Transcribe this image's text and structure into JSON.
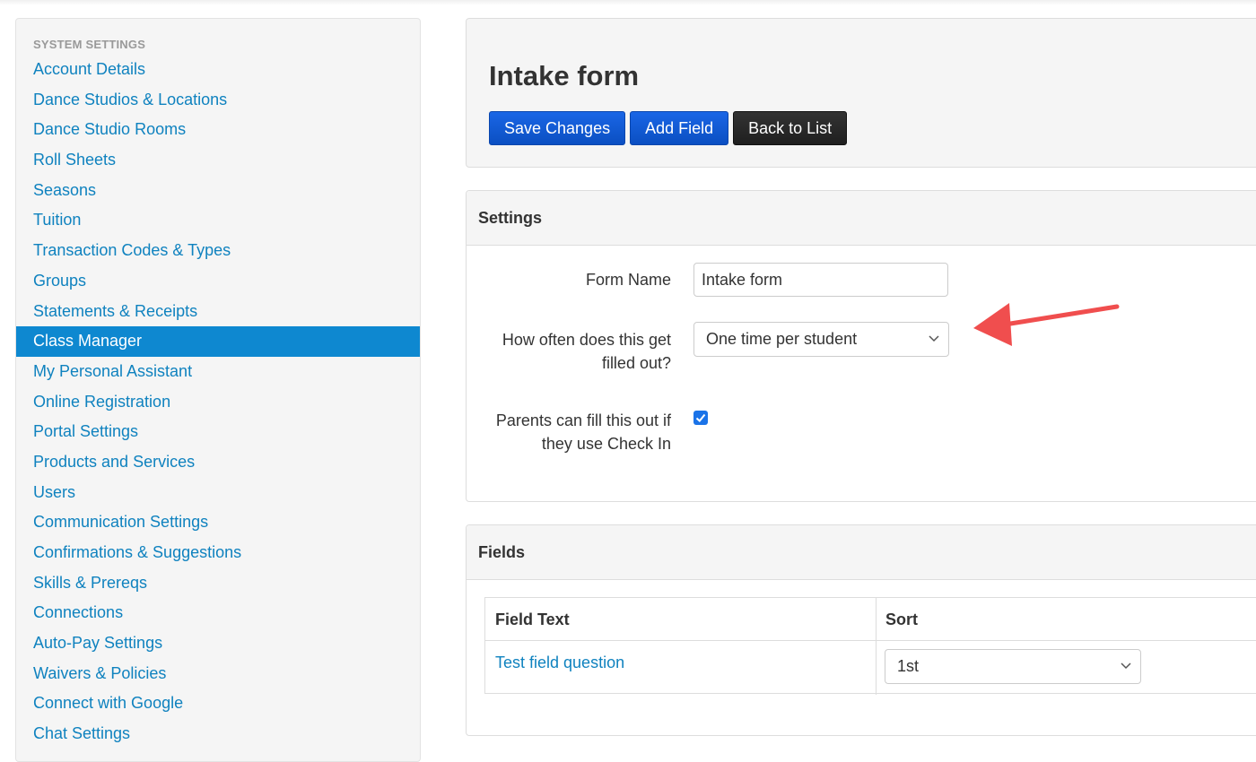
{
  "sidebar": {
    "header": "SYSTEM SETTINGS",
    "items": [
      {
        "label": "Account Details"
      },
      {
        "label": "Dance Studios & Locations"
      },
      {
        "label": "Dance Studio Rooms"
      },
      {
        "label": "Roll Sheets"
      },
      {
        "label": "Seasons"
      },
      {
        "label": "Tuition"
      },
      {
        "label": "Transaction Codes & Types"
      },
      {
        "label": "Groups"
      },
      {
        "label": "Statements & Receipts"
      },
      {
        "label": "Class Manager",
        "active": true
      },
      {
        "label": "My Personal Assistant"
      },
      {
        "label": "Online Registration"
      },
      {
        "label": "Portal Settings"
      },
      {
        "label": "Products and Services"
      },
      {
        "label": "Users"
      },
      {
        "label": "Communication Settings"
      },
      {
        "label": "Confirmations & Suggestions"
      },
      {
        "label": "Skills & Prereqs"
      },
      {
        "label": "Connections"
      },
      {
        "label": "Auto-Pay Settings"
      },
      {
        "label": "Waivers & Policies"
      },
      {
        "label": "Connect with Google"
      },
      {
        "label": "Chat Settings"
      }
    ]
  },
  "page": {
    "title": "Intake form",
    "buttons": {
      "save": "Save Changes",
      "add_field": "Add Field",
      "back": "Back to List"
    }
  },
  "settings": {
    "heading": "Settings",
    "form_name": {
      "label": "Form Name",
      "value": "Intake form"
    },
    "frequency": {
      "label": "How often does this get filled out?",
      "value": "One time per student"
    },
    "parents_checkin": {
      "label": "Parents can fill this out if they use Check In",
      "checked": true
    }
  },
  "fields": {
    "heading": "Fields",
    "columns": {
      "text": "Field Text",
      "sort": "Sort"
    },
    "rows": [
      {
        "text": "Test field question",
        "sort": "1st"
      }
    ]
  },
  "colors": {
    "link": "#0f82bf",
    "active_bg": "#0e88d0",
    "primary_btn": "#1a66e6",
    "dark_btn": "#222222",
    "annotation_arrow": "#f04e4e"
  }
}
